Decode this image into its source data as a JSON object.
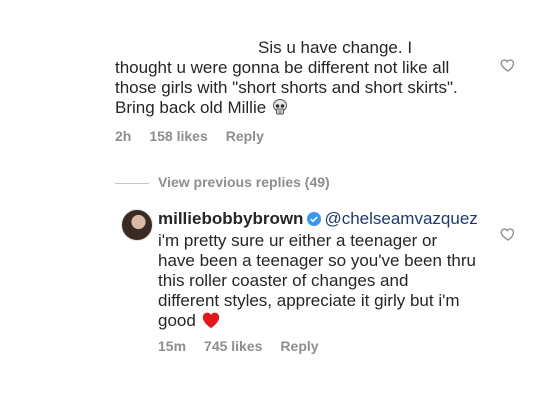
{
  "comment1": {
    "text_line1": "Sis u have change. I",
    "text_line2": "thought u were gonna be different not like all",
    "text_line3": "those girls with \"short shorts and short skirts\".",
    "text_line4": "Bring back old Millie",
    "emoji": "skull-emoji",
    "time": "2h",
    "likes": "158 likes",
    "reply": "Reply"
  },
  "view_replies": "View previous replies (49)",
  "comment2": {
    "username": "milliebobbybrown",
    "mention": "@chelseamvazquez",
    "text_line1": "i'm pretty sure ur either a teenager or",
    "text_line2": "have been a teenager so you've been thru",
    "text_line3": "this roller coaster of changes and",
    "text_line4": "different styles, appreciate it girly but i'm",
    "text_line5": "good",
    "emoji": "red-heart-emoji",
    "time": "15m",
    "likes": "745 likes",
    "reply": "Reply"
  },
  "colors": {
    "mention": "#1f3a6e",
    "verified": "#3897f0",
    "heart": "#e0181e",
    "meta": "#8e8e8e"
  }
}
